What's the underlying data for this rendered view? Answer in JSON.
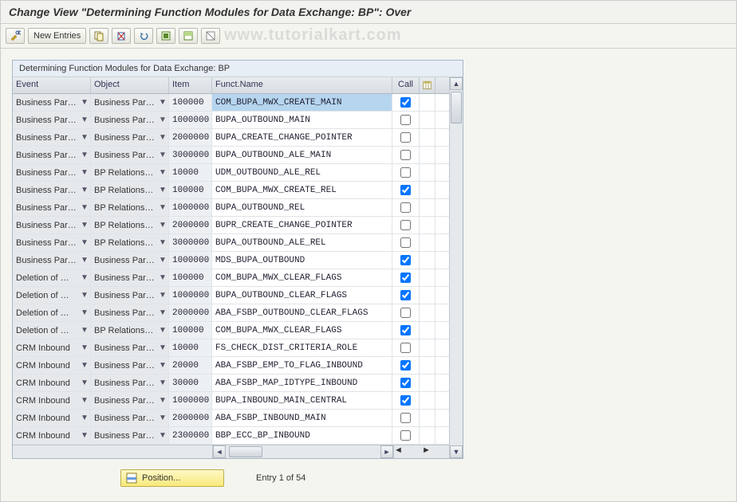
{
  "title": "Change View \"Determining Function Modules for Data Exchange: BP\": Over",
  "watermark": "www.tutorialkart.com",
  "toolbar": {
    "new_entries_label": "New Entries"
  },
  "panel": {
    "title": "Determining Function Modules for Data Exchange: BP"
  },
  "columns": {
    "event": "Event",
    "object": "Object",
    "item": "Item",
    "funct": "Funct.Name",
    "call": "Call"
  },
  "rows": [
    {
      "event": "Business Par…",
      "object": "Business Par…",
      "item": "100000",
      "funct": "COM_BUPA_MWX_CREATE_MAIN",
      "call": true,
      "selected": true
    },
    {
      "event": "Business Par…",
      "object": "Business Par…",
      "item": "1000000",
      "funct": "BUPA_OUTBOUND_MAIN",
      "call": false
    },
    {
      "event": "Business Par…",
      "object": "Business Par…",
      "item": "2000000",
      "funct": "BUPA_CREATE_CHANGE_POINTER",
      "call": false
    },
    {
      "event": "Business Par…",
      "object": "Business Par…",
      "item": "3000000",
      "funct": "BUPA_OUTBOUND_ALE_MAIN",
      "call": false
    },
    {
      "event": "Business Par…",
      "object": "BP Relations…",
      "item": "10000",
      "funct": "UDM_OUTBOUND_ALE_REL",
      "call": false
    },
    {
      "event": "Business Par…",
      "object": "BP Relations…",
      "item": "100000",
      "funct": "COM_BUPA_MWX_CREATE_REL",
      "call": true
    },
    {
      "event": "Business Par…",
      "object": "BP Relations…",
      "item": "1000000",
      "funct": "BUPA_OUTBOUND_REL",
      "call": false
    },
    {
      "event": "Business Par…",
      "object": "BP Relations…",
      "item": "2000000",
      "funct": "BUPR_CREATE_CHANGE_POINTER",
      "call": false
    },
    {
      "event": "Business Par…",
      "object": "BP Relations…",
      "item": "3000000",
      "funct": "BUPA_OUTBOUND_ALE_REL",
      "call": false
    },
    {
      "event": "Business Par…",
      "object": "Business Par…",
      "item": "1000000",
      "funct": "MDS_BUPA_OUTBOUND",
      "call": true
    },
    {
      "event": "Deletion of …",
      "object": "Business Par…",
      "item": "100000",
      "funct": "COM_BUPA_MWX_CLEAR_FLAGS",
      "call": true
    },
    {
      "event": "Deletion of …",
      "object": "Business Par…",
      "item": "1000000",
      "funct": "BUPA_OUTBOUND_CLEAR_FLAGS",
      "call": true
    },
    {
      "event": "Deletion of …",
      "object": "Business Par…",
      "item": "2000000",
      "funct": "ABA_FSBP_OUTBOUND_CLEAR_FLAGS",
      "call": false
    },
    {
      "event": "Deletion of …",
      "object": "BP Relations…",
      "item": "100000",
      "funct": "COM_BUPA_MWX_CLEAR_FLAGS",
      "call": true
    },
    {
      "event": "CRM Inbound",
      "object": "Business Par…",
      "item": "10000",
      "funct": "FS_CHECK_DIST_CRITERIA_ROLE",
      "call": false
    },
    {
      "event": "CRM Inbound",
      "object": "Business Par…",
      "item": "20000",
      "funct": "ABA_FSBP_EMP_TO_FLAG_INBOUND",
      "call": true
    },
    {
      "event": "CRM Inbound",
      "object": "Business Par…",
      "item": "30000",
      "funct": "ABA_FSBP_MAP_IDTYPE_INBOUND",
      "call": true
    },
    {
      "event": "CRM Inbound",
      "object": "Business Par…",
      "item": "1000000",
      "funct": "BUPA_INBOUND_MAIN_CENTRAL",
      "call": true
    },
    {
      "event": "CRM Inbound",
      "object": "Business Par…",
      "item": "2000000",
      "funct": "ABA_FSBP_INBOUND_MAIN",
      "call": false
    },
    {
      "event": "CRM Inbound",
      "object": "Business Par…",
      "item": "2300000",
      "funct": "BBP_ECC_BP_INBOUND",
      "call": false
    }
  ],
  "footer": {
    "position_label": "Position...",
    "entry_label": "Entry 1 of 54"
  }
}
